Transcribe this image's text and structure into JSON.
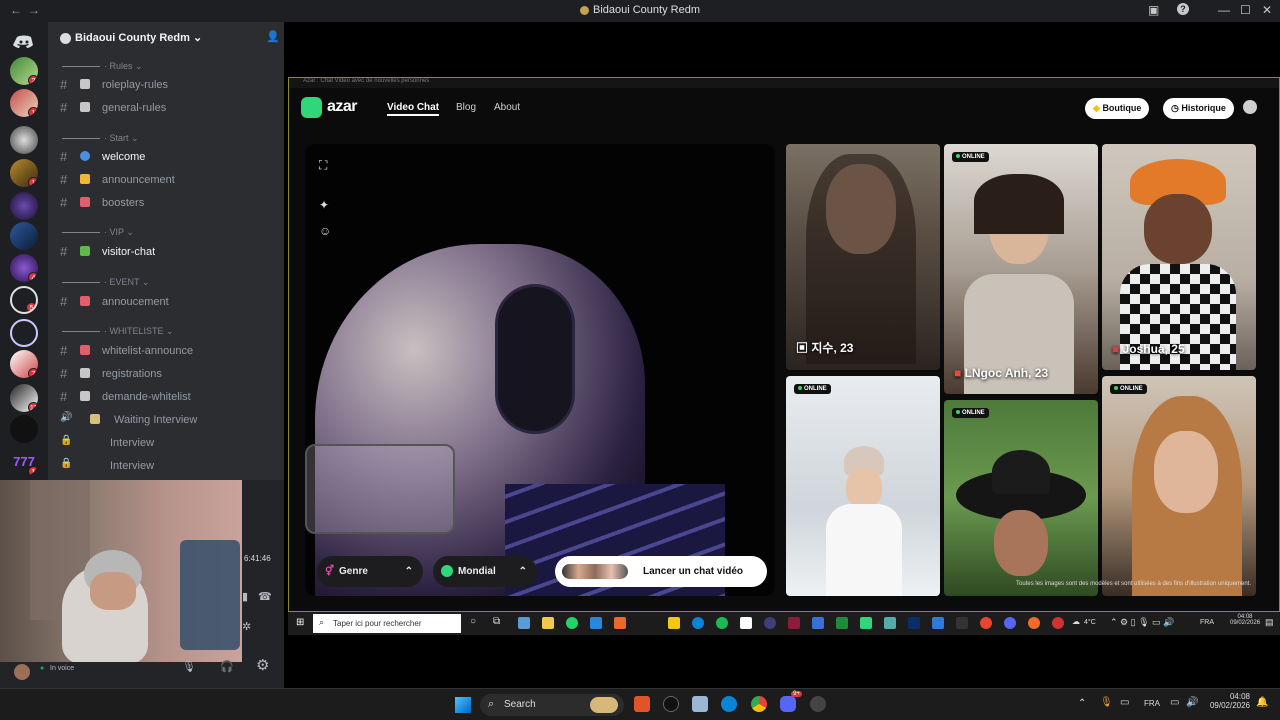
{
  "window": {
    "title": "Bidaoui County Redm"
  },
  "server": {
    "name": "Bidaoui County Redm"
  },
  "guild_badges": [
    "2",
    "1",
    "",
    "1",
    "",
    "",
    "4",
    "5",
    "",
    "7",
    "11",
    "",
    "1"
  ],
  "categories": [
    {
      "label": "Rules"
    },
    {
      "label": "Start"
    },
    {
      "label": "VIP"
    },
    {
      "label": "EVENT"
    },
    {
      "label": "WHITELISTE"
    }
  ],
  "channels": [
    {
      "label": "roleplay-rules"
    },
    {
      "label": "general-rules"
    },
    {
      "label": "welcome"
    },
    {
      "label": "announcement"
    },
    {
      "label": "boosters"
    },
    {
      "label": "visitor-chat"
    },
    {
      "label": "annoucement"
    },
    {
      "label": "whitelist-announce"
    },
    {
      "label": "registrations"
    },
    {
      "label": "demande-whitelist"
    },
    {
      "label": "Waiting Interview"
    },
    {
      "label": "Interview"
    },
    {
      "label": "Interview"
    }
  ],
  "voice": {
    "timer": "6:41:46",
    "status": "In voice"
  },
  "azar": {
    "tab_title": "Azar : Chat Vidéo avec de nouvelles personnes",
    "logo": "azar",
    "nav": {
      "video_chat": "Video Chat",
      "blog": "Blog",
      "about": "About"
    },
    "boutique": "Boutique",
    "historique": "Historique",
    "genre": "Genre",
    "mondial": "Mondial",
    "start_button": "Lancer un chat vidéo",
    "online_label": "ONLINE",
    "profiles": [
      {
        "name": "지수, 23"
      },
      {
        "name": "LNgoc Anh, 23"
      },
      {
        "name": "Joshua, 25"
      }
    ],
    "disclaimer": "Toutes les images sont des modèles et sont utilisées à des fins d'illustration uniquement."
  },
  "inner_taskbar": {
    "search_placeholder": "Taper ici pour rechercher",
    "weather": "4°C",
    "lang": "FRA",
    "time": "04:08",
    "date": "09/02/2026"
  },
  "taskbar": {
    "search": "Search",
    "lang": "FRA",
    "time": "04:08",
    "date": "09/02/2026",
    "discord_badge": "9+"
  },
  "colors": {
    "discord_bg": "#2b2d31",
    "azar_accent": "#2fd77a",
    "badge_red": "#da373c"
  }
}
